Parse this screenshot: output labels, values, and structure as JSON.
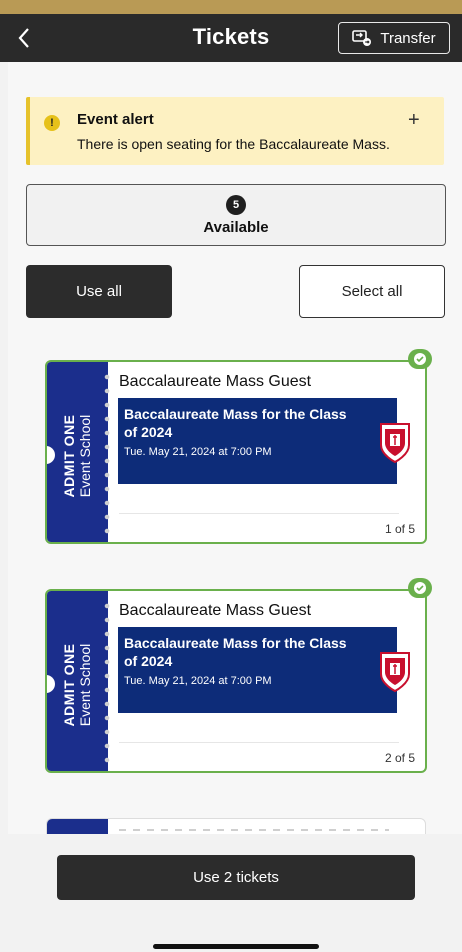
{
  "header": {
    "title": "Tickets",
    "transfer_label": "Transfer"
  },
  "alert": {
    "title": "Event alert",
    "text": "There is open seating for the Baccalaureate Mass.",
    "expand_symbol": "+"
  },
  "available": {
    "count": "5",
    "label": "Available"
  },
  "actions": {
    "use_all": "Use all",
    "select_all": "Select all",
    "use_tickets": "Use 2 tickets"
  },
  "tickets": [
    {
      "stub_admit": "ADMIT ONE",
      "stub_school": "Event School",
      "title": "Baccalaureate Mass Guest",
      "event_name": "Baccalaureate Mass for the Class of 2024",
      "event_date": "Tue. May 21, 2024 at 7:00 PM",
      "position": "1 of 5",
      "selected": true
    },
    {
      "stub_admit": "ADMIT ONE",
      "stub_school": "Event School",
      "title": "Baccalaureate Mass Guest",
      "event_name": "Baccalaureate Mass for the Class of 2024",
      "event_date": "Tue. May 21, 2024 at 7:00 PM",
      "position": "2 of 5",
      "selected": true
    }
  ],
  "colors": {
    "ticket_stub": "#1b2e8c",
    "event_box": "#0d2c79",
    "selected_border": "#6ab04c",
    "alert_bg": "#fdf1c2",
    "header_bg": "#2a2a2a"
  },
  "icons": {
    "back": "chevron-left-icon",
    "transfer": "transfer-icon",
    "alert": "exclamation-icon",
    "selected": "check-icon",
    "logo": "school-crest-icon"
  }
}
